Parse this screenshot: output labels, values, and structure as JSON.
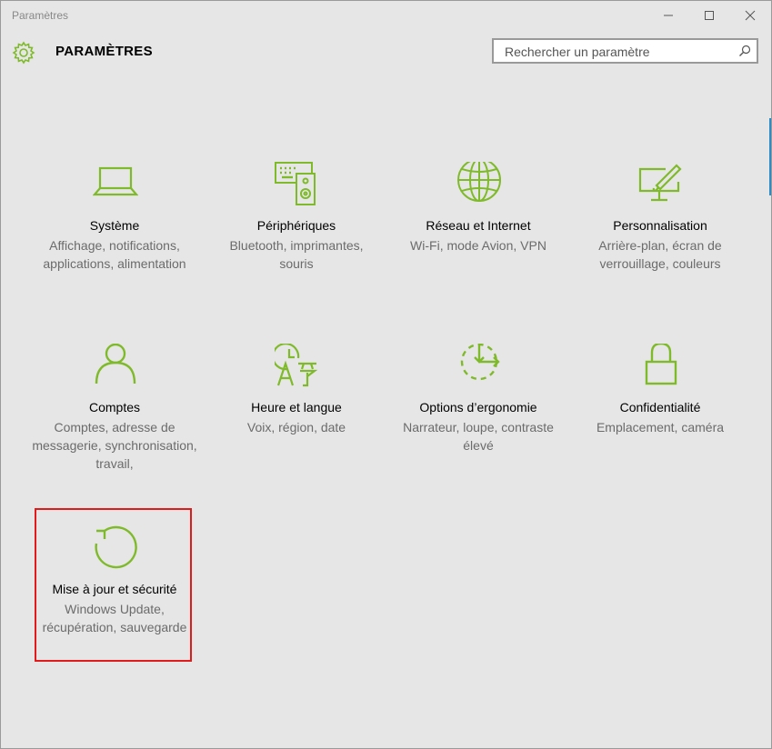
{
  "window": {
    "title": "Paramètres"
  },
  "header": {
    "title": "PARAMÈTRES"
  },
  "search": {
    "placeholder": "Rechercher un paramètre"
  },
  "accent_color": "#7fba2a",
  "highlight_color": "#e21a1a",
  "tiles": [
    {
      "name": "Système",
      "desc": "Affichage, notifications, applications, alimentation",
      "icon": "laptop-icon"
    },
    {
      "name": "Périphériques",
      "desc": "Bluetooth, imprimantes, souris",
      "icon": "devices-icon"
    },
    {
      "name": "Réseau et Internet",
      "desc": "Wi-Fi, mode Avion, VPN",
      "icon": "globe-icon"
    },
    {
      "name": "Personnalisation",
      "desc": "Arrière-plan, écran de verrouillage, couleurs",
      "icon": "personalization-icon"
    },
    {
      "name": "Comptes",
      "desc": "Comptes, adresse de messagerie, synchronisation, travail,",
      "icon": "person-icon"
    },
    {
      "name": "Heure et langue",
      "desc": "Voix, région, date",
      "icon": "time-language-icon"
    },
    {
      "name": "Options d’ergonomie",
      "desc": "Narrateur, loupe, contraste élevé",
      "icon": "ease-of-access-icon"
    },
    {
      "name": "Confidentialité",
      "desc": "Emplacement, caméra",
      "icon": "lock-icon"
    },
    {
      "name": "Mise à jour et sécurité",
      "desc": "Windows Update, récupération, sauvegarde",
      "icon": "update-icon"
    }
  ]
}
